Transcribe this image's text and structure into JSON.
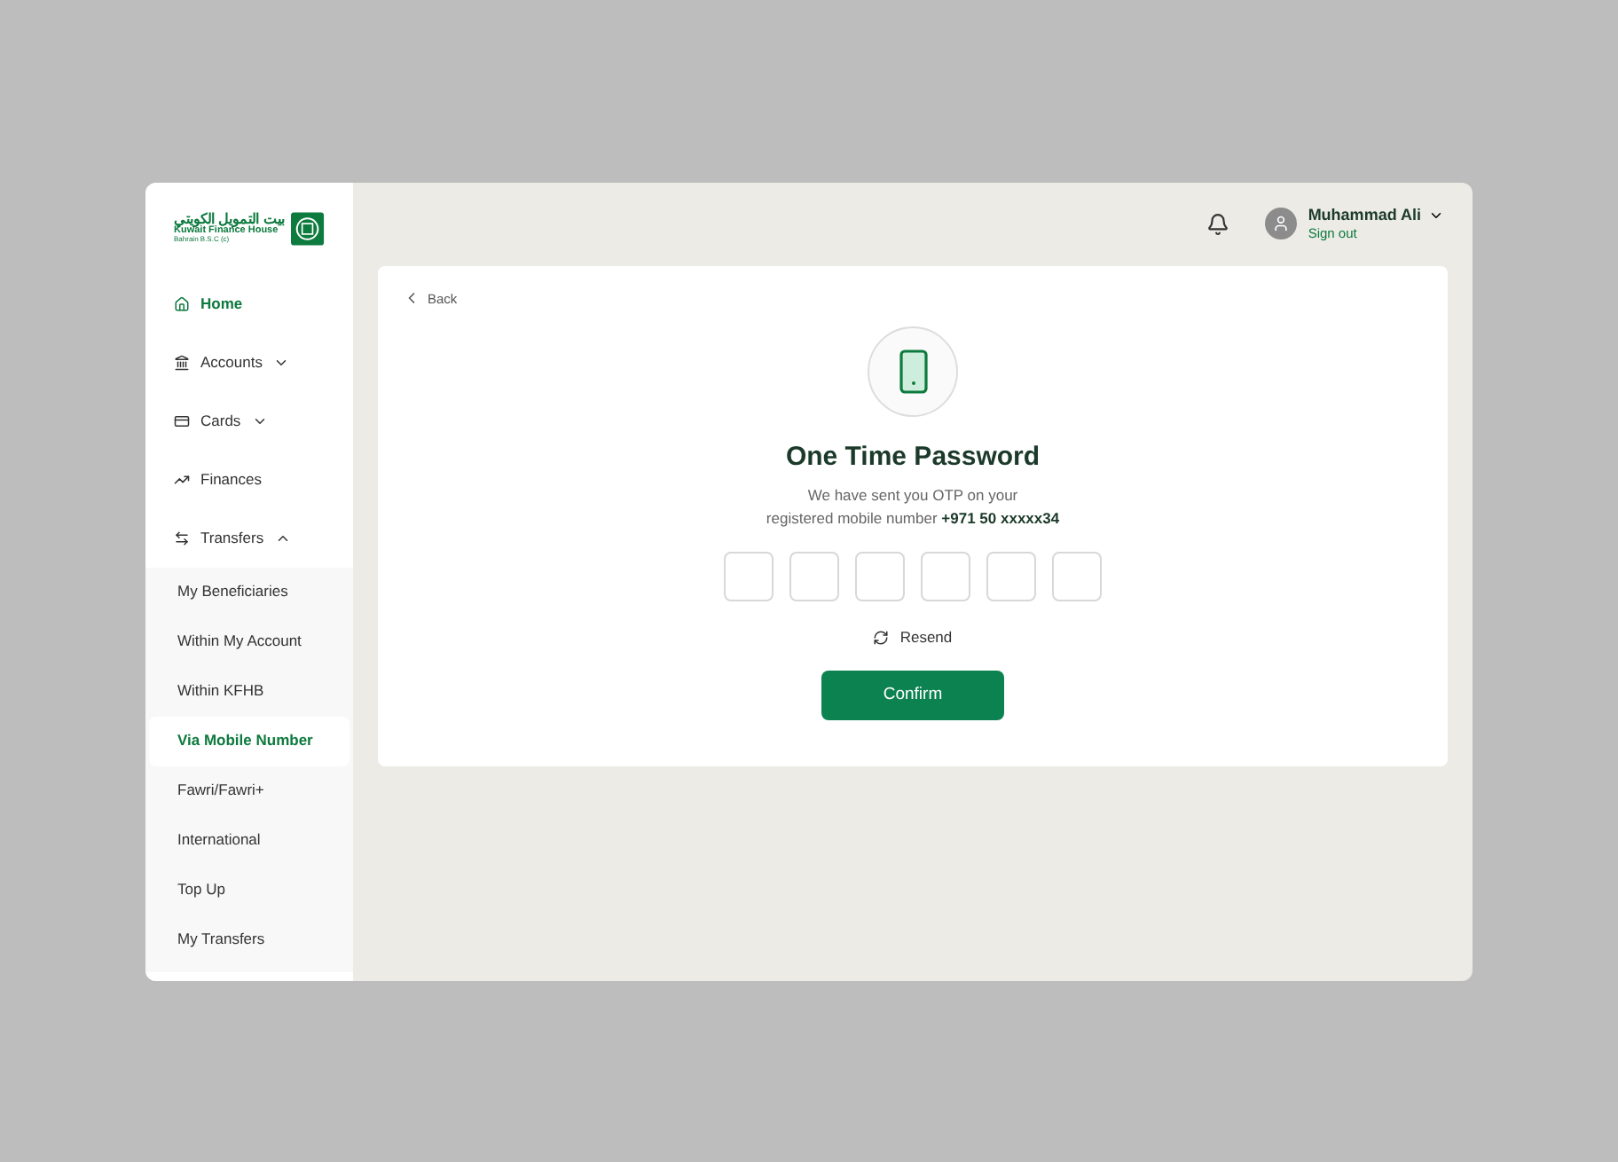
{
  "logo": {
    "arabic": "بيت التمويل الكويتي",
    "english": "Kuwait Finance House",
    "subtitle": "Bahrain B.S.C (c)"
  },
  "nav": [
    {
      "label": "Home",
      "selected": true
    },
    {
      "label": "Accounts",
      "expanded": false,
      "selected": false
    },
    {
      "label": "Cards",
      "expanded": false,
      "selected": false
    },
    {
      "label": "Finances",
      "selected": false
    },
    {
      "label": "Transfers",
      "expanded": true,
      "selected": false,
      "children": [
        {
          "label": "My Beneficiaries",
          "selected": false
        },
        {
          "label": "Within My Account",
          "selected": false
        },
        {
          "label": "Within KFHB",
          "selected": false
        },
        {
          "label": "Via Mobile Number",
          "selected": true
        },
        {
          "label": "Fawri/Fawri+",
          "selected": false
        },
        {
          "label": "International",
          "selected": false
        },
        {
          "label": "Top Up",
          "selected": false
        },
        {
          "label": "My Transfers",
          "selected": false
        }
      ]
    }
  ],
  "user": {
    "name": "Muhammad Ali",
    "action": "Sign out"
  },
  "back": "Back",
  "title": "One Time Password",
  "message_line1": "We have sent you OTP on your",
  "message_line2": "registered mobile number",
  "phone": "+971 50 xxxxx34",
  "resend": "Resend",
  "confirm": "Confirm"
}
